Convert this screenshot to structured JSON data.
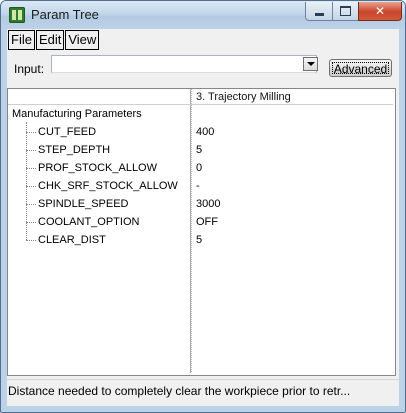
{
  "window": {
    "title": "Param Tree"
  },
  "menu": [
    "File",
    "Edit",
    "View"
  ],
  "input": {
    "label": "Input:",
    "value": "",
    "advanced_label": "Advanced"
  },
  "tree": {
    "column_header": "3. Trajectory Milling",
    "root": "Manufacturing Parameters",
    "rows": [
      {
        "name": "CUT_FEED",
        "value": "400"
      },
      {
        "name": "STEP_DEPTH",
        "value": "5"
      },
      {
        "name": "PROF_STOCK_ALLOW",
        "value": "0"
      },
      {
        "name": "CHK_SRF_STOCK_ALLOW",
        "value": "-"
      },
      {
        "name": "SPINDLE_SPEED",
        "value": "3000"
      },
      {
        "name": "COOLANT_OPTION",
        "value": "OFF"
      },
      {
        "name": "CLEAR_DIST",
        "value": "5"
      }
    ]
  },
  "status": {
    "text": "Distance needed to completely clear the workpiece prior to retr..."
  }
}
